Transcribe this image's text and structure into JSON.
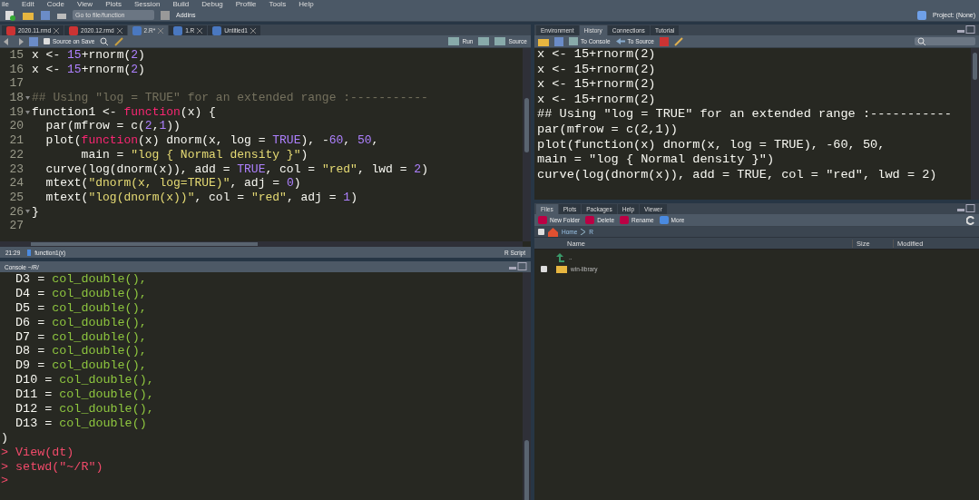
{
  "menu": [
    "ile",
    "Edit",
    "Code",
    "View",
    "Plots",
    "Session",
    "Build",
    "Debug",
    "Profile",
    "Tools",
    "Help"
  ],
  "toolbar": {
    "goto_placeholder": "Go to file/function",
    "addins": "Addins",
    "project": "Project: (None)"
  },
  "source": {
    "tabs": [
      {
        "label": "2020.11.rmd",
        "kind": "rmd",
        "selected": false
      },
      {
        "label": "2020.12.rmd",
        "kind": "rmd",
        "selected": false
      },
      {
        "label": "2.R*",
        "kind": "r",
        "selected": true
      },
      {
        "label": "1.R",
        "kind": "r",
        "selected": false
      },
      {
        "label": "Untitled1",
        "kind": "r",
        "selected": false
      }
    ],
    "source_on_save": {
      "label": "Source on Save",
      "checked": false
    },
    "run": "Run",
    "source_button": "Source",
    "lines": [
      {
        "num": "15",
        "fold": false,
        "tokens": [
          {
            "kind": "plain",
            "text": "x <- "
          },
          {
            "kind": "number",
            "text": "15"
          },
          {
            "kind": "plain",
            "text": "+rnorm("
          },
          {
            "kind": "number",
            "text": "2"
          },
          {
            "kind": "plain",
            "text": ")"
          }
        ]
      },
      {
        "num": "16",
        "fold": false,
        "tokens": [
          {
            "kind": "plain",
            "text": "x <- "
          },
          {
            "kind": "number",
            "text": "15"
          },
          {
            "kind": "plain",
            "text": "+rnorm("
          },
          {
            "kind": "number",
            "text": "2"
          },
          {
            "kind": "plain",
            "text": ")"
          }
        ]
      },
      {
        "num": "17",
        "fold": false
      },
      {
        "num": "18",
        "fold": true,
        "tokens": [
          {
            "kind": "comment",
            "text": "## Using \"log = TRUE\" for an extended range :-----------"
          }
        ]
      },
      {
        "num": "19",
        "fold": true,
        "tokens": [
          {
            "kind": "plain",
            "text": "function1 <- "
          },
          {
            "kind": "keyword",
            "text": "function"
          },
          {
            "kind": "plain",
            "text": "(x) {"
          }
        ]
      },
      {
        "num": "20",
        "fold": false,
        "tokens": [
          {
            "kind": "plain",
            "text": "  par(mfrow = c("
          },
          {
            "kind": "number",
            "text": "2"
          },
          {
            "kind": "plain",
            "text": ","
          },
          {
            "kind": "number",
            "text": "1"
          },
          {
            "kind": "plain",
            "text": "))"
          }
        ]
      },
      {
        "num": "21",
        "fold": false,
        "tokens": [
          {
            "kind": "plain",
            "text": "  plot("
          },
          {
            "kind": "keyword",
            "text": "function"
          },
          {
            "kind": "plain",
            "text": "(x) dnorm(x, log = "
          },
          {
            "kind": "number",
            "text": "TRUE"
          },
          {
            "kind": "plain",
            "text": "), -"
          },
          {
            "kind": "number",
            "text": "60"
          },
          {
            "kind": "plain",
            "text": ", "
          },
          {
            "kind": "number",
            "text": "50"
          },
          {
            "kind": "plain",
            "text": ","
          }
        ]
      },
      {
        "num": "22",
        "fold": false,
        "tokens": [
          {
            "kind": "plain",
            "text": "       main = "
          },
          {
            "kind": "string",
            "text": "\"log { Normal density }\""
          },
          {
            "kind": "plain",
            "text": ")"
          }
        ]
      },
      {
        "num": "23",
        "fold": false,
        "tokens": [
          {
            "kind": "plain",
            "text": "  curve(log(dnorm(x)), add = "
          },
          {
            "kind": "number",
            "text": "TRUE"
          },
          {
            "kind": "plain",
            "text": ", col = "
          },
          {
            "kind": "string",
            "text": "\"red\""
          },
          {
            "kind": "plain",
            "text": ", lwd = "
          },
          {
            "kind": "number",
            "text": "2"
          },
          {
            "kind": "plain",
            "text": ")"
          }
        ]
      },
      {
        "num": "24",
        "fold": false,
        "tokens": [
          {
            "kind": "plain",
            "text": "  mtext("
          },
          {
            "kind": "string",
            "text": "\"dnorm(x, log=TRUE)\""
          },
          {
            "kind": "plain",
            "text": ", adj = "
          },
          {
            "kind": "number",
            "text": "0"
          },
          {
            "kind": "plain",
            "text": ")"
          }
        ]
      },
      {
        "num": "25",
        "fold": false,
        "tokens": [
          {
            "kind": "plain",
            "text": "  mtext("
          },
          {
            "kind": "string",
            "text": "\"log(dnorm(x))\""
          },
          {
            "kind": "plain",
            "text": ", col = "
          },
          {
            "kind": "string",
            "text": "\"red\""
          },
          {
            "kind": "plain",
            "text": ", adj = "
          },
          {
            "kind": "number",
            "text": "1"
          },
          {
            "kind": "plain",
            "text": ")"
          }
        ]
      },
      {
        "num": "26",
        "fold": true,
        "tokens": [
          {
            "kind": "plain",
            "text": "}"
          }
        ]
      },
      {
        "num": "27",
        "fold": false
      }
    ],
    "status": {
      "position": "21:29",
      "scope": "function1(x)",
      "filetype": "R Script"
    }
  },
  "console": {
    "title": "Console ~/R/",
    "lines": [
      {
        "tokens": [
          {
            "kind": "plain",
            "text": "  D3 = "
          },
          {
            "kind": "fn",
            "text": "col_double(),"
          }
        ]
      },
      {
        "tokens": [
          {
            "kind": "plain",
            "text": "  D4 = "
          },
          {
            "kind": "fn",
            "text": "col_double(),"
          }
        ]
      },
      {
        "tokens": [
          {
            "kind": "plain",
            "text": "  D5 = "
          },
          {
            "kind": "fn",
            "text": "col_double(),"
          }
        ]
      },
      {
        "tokens": [
          {
            "kind": "plain",
            "text": "  D6 = "
          },
          {
            "kind": "fn",
            "text": "col_double(),"
          }
        ]
      },
      {
        "tokens": [
          {
            "kind": "plain",
            "text": "  D7 = "
          },
          {
            "kind": "fn",
            "text": "col_double(),"
          }
        ]
      },
      {
        "tokens": [
          {
            "kind": "plain",
            "text": "  D8 = "
          },
          {
            "kind": "fn",
            "text": "col_double(),"
          }
        ]
      },
      {
        "tokens": [
          {
            "kind": "plain",
            "text": "  D9 = "
          },
          {
            "kind": "fn",
            "text": "col_double(),"
          }
        ]
      },
      {
        "tokens": [
          {
            "kind": "plain",
            "text": "  D10 = "
          },
          {
            "kind": "fn",
            "text": "col_double(),"
          }
        ]
      },
      {
        "tokens": [
          {
            "kind": "plain",
            "text": "  D11 = "
          },
          {
            "kind": "fn",
            "text": "col_double(),"
          }
        ]
      },
      {
        "tokens": [
          {
            "kind": "plain",
            "text": "  D12 = "
          },
          {
            "kind": "fn",
            "text": "col_double(),"
          }
        ]
      },
      {
        "tokens": [
          {
            "kind": "plain",
            "text": "  D13 = "
          },
          {
            "kind": "fn",
            "text": "col_double()"
          }
        ]
      },
      {
        "tokens": [
          {
            "kind": "plain",
            "text": ")"
          }
        ]
      },
      {
        "tokens": [
          {
            "kind": "input",
            "text": "> View(dt)"
          }
        ]
      },
      {
        "tokens": [
          {
            "kind": "input",
            "text": "> setwd(\"~/R\")"
          }
        ]
      },
      {
        "tokens": [
          {
            "kind": "input",
            "text": "> "
          }
        ]
      }
    ]
  },
  "history": {
    "tabs": [
      {
        "label": "Environment",
        "selected": false
      },
      {
        "label": "History",
        "selected": true
      },
      {
        "label": "Connections",
        "selected": false
      },
      {
        "label": "Tutorial",
        "selected": false
      }
    ],
    "to_console": "To Console",
    "to_source": "To Source",
    "lines": [
      "x <- 15+rnorm(2)",
      "x <- 15+rnorm(2)",
      "x <- 15+rnorm(2)",
      "x <- 15+rnorm(2)",
      "## Using \"log = TRUE\" for an extended range :-----------",
      "par(mfrow = c(2,1))",
      "plot(function(x) dnorm(x, log = TRUE), -60, 50,",
      "main = \"log { Normal density }\")",
      "curve(log(dnorm(x)), add = TRUE, col = \"red\", lwd = 2)"
    ]
  },
  "files": {
    "tabs": [
      {
        "label": "Files",
        "selected": true
      },
      {
        "label": "Plots",
        "selected": false
      },
      {
        "label": "Packages",
        "selected": false
      },
      {
        "label": "Help",
        "selected": false
      },
      {
        "label": "Viewer",
        "selected": false
      }
    ],
    "actions": [
      "New Folder",
      "Delete",
      "Rename",
      "More"
    ],
    "select_all": {
      "checked": false
    },
    "breadcrumb": [
      "Home",
      "R"
    ],
    "columns": [
      "Name",
      "Size",
      "Modified"
    ],
    "rows": [
      {
        "kind": "parent",
        "name": ".."
      },
      {
        "kind": "folder",
        "name": "win-library",
        "checked": false
      }
    ]
  }
}
